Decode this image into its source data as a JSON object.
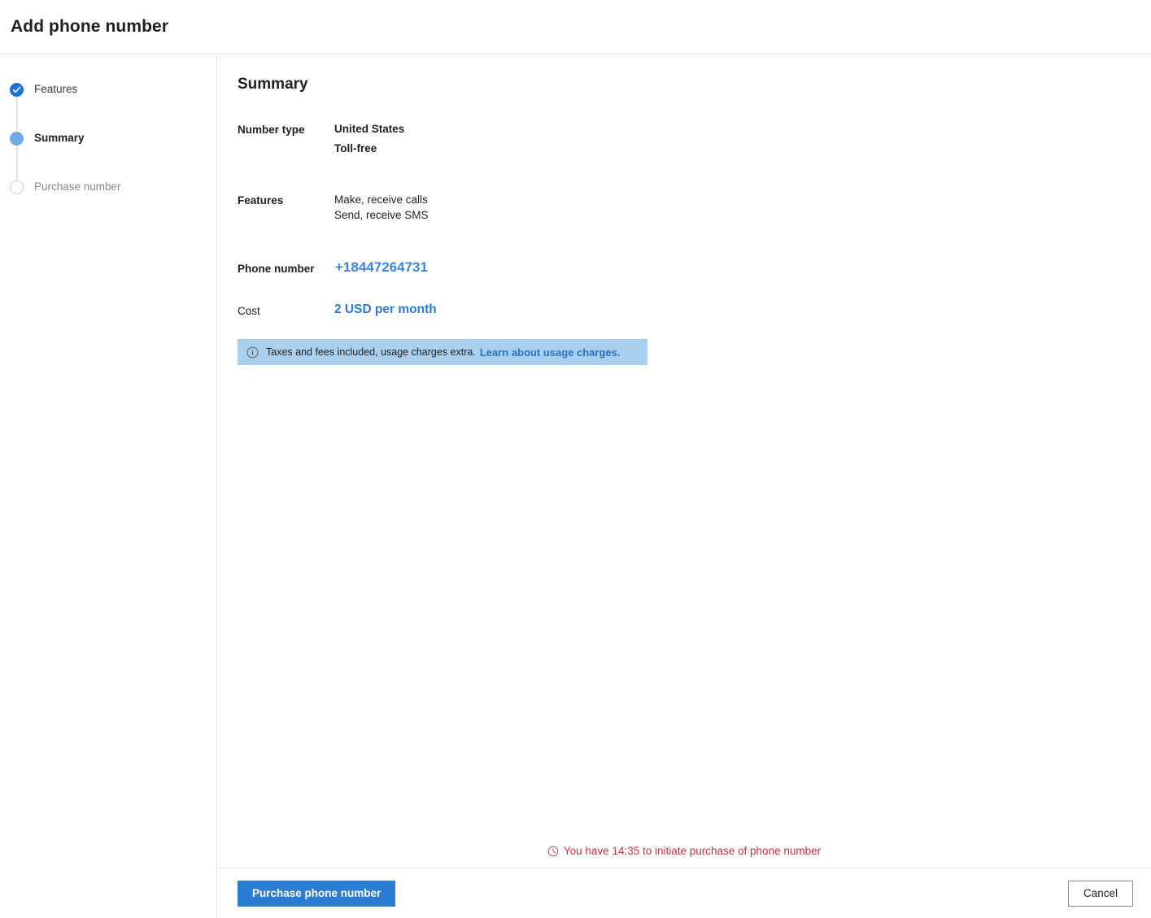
{
  "header": {
    "title": "Add phone number"
  },
  "wizard": {
    "steps": [
      {
        "label": "Features",
        "state": "done",
        "icon": "check-circle-icon"
      },
      {
        "label": "Summary",
        "state": "current",
        "icon": "filled-circle-icon"
      },
      {
        "label": "Purchase number",
        "state": "todo",
        "icon": "empty-circle-icon"
      }
    ]
  },
  "main": {
    "section_title": "Summary",
    "rows": {
      "number_type": {
        "label": "Number type",
        "country": "United States",
        "kind": "Toll-free"
      },
      "features": {
        "label": "Features",
        "items": [
          "Make, receive calls",
          "Send, receive SMS"
        ]
      },
      "phone_number": {
        "label": "Phone number",
        "value": "+18447264731"
      },
      "cost": {
        "label": "Cost",
        "value": "2 USD per month"
      }
    },
    "info_bar": {
      "icon": "info-circle-icon",
      "text": "Taxes and fees included, usage charges extra.",
      "link_label": "Learn about usage charges."
    },
    "timer": {
      "icon": "clock-icon",
      "text": "You have 14:35 to initiate purchase of phone number"
    }
  },
  "footer": {
    "primary_label": "Purchase phone number",
    "cancel_label": "Cancel"
  },
  "colors": {
    "accent": "#2b7cd3",
    "step_done": "#1974d2",
    "step_current": "#6fa9e8",
    "link": "#2a6fc0",
    "phone_blue": "#3b86e0",
    "cost_blue": "#2b7bd4",
    "info_bg": "#a9d0ef",
    "timer_red": "#c4314b",
    "divider": "#e6e6e6"
  }
}
